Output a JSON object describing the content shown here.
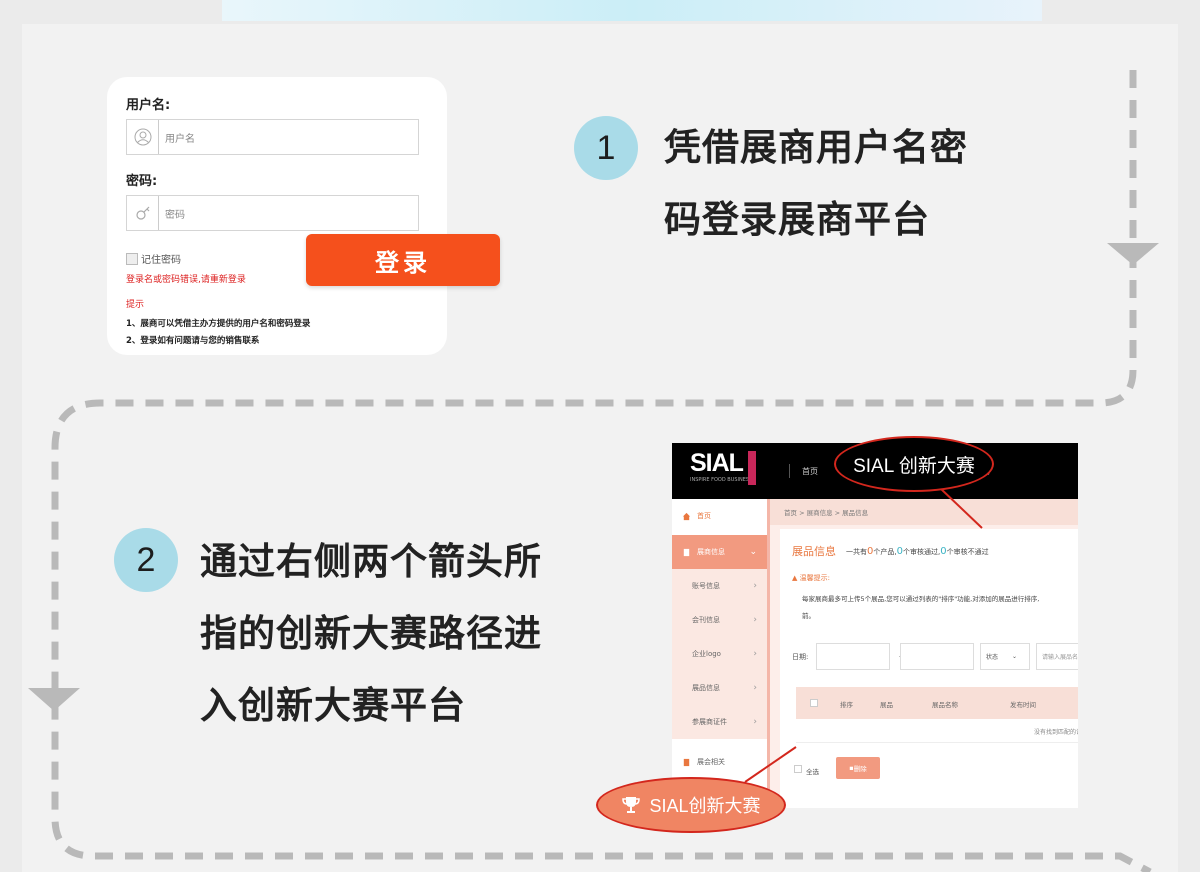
{
  "step1": {
    "number": "1",
    "line1": "凭借展商用户名密",
    "line2": "码登录展商平台"
  },
  "step2": {
    "number": "2",
    "line1": "通过右侧两个箭头所",
    "line2": "指的创新大赛路径进",
    "line3": "入创新大赛平台"
  },
  "login": {
    "username_label": "用户名:",
    "username_placeholder": "用户名",
    "password_label": "密码:",
    "password_placeholder": "密码",
    "remember": "记住密码",
    "error": "登录名或密码错误,请重新登录",
    "tips_title": "提示",
    "tip1": "1、展商可以凭借主办方提供的用户名和密码登录",
    "tip2": "2、登录如有问题请与您的销售联系",
    "button": "登录"
  },
  "platform": {
    "logo": "SIAL",
    "logo_sub": "INSPIRE FOOD BUSINESS",
    "nav_home": "首页",
    "nav_more": "动",
    "breadcrumb": "首页 > 展商信息 > 展品信息",
    "sidebar": [
      {
        "label": "首页"
      },
      {
        "label": "展商信息"
      },
      {
        "label": "账号信息"
      },
      {
        "label": "会刊信息"
      },
      {
        "label": "企业logo"
      },
      {
        "label": "展品信息"
      },
      {
        "label": "参展商证件"
      },
      {
        "label": "展会相关"
      }
    ],
    "title": "展品信息",
    "stats_pre": "一共有",
    "stats_n1": "0",
    "stats_mid1": "个产品,",
    "stats_n2": "0",
    "stats_mid2": "个审核通过,",
    "stats_n3": "0",
    "stats_post": "个审核不通过",
    "warn_title": "温馨提示:",
    "warn_body": "每家展商最多可上传5个展品,您可以通过列表的\"排序\"功能,对添加的展品进行排序,",
    "warn_body2": "前。",
    "date_label": "日期:",
    "date_sep": "-",
    "status_select": "状态",
    "search_placeholder": "请输入展品名",
    "columns": [
      "排序",
      "展品",
      "展品名称",
      "发布时间"
    ],
    "empty": "没有找到匹配的记",
    "select_all": "全选",
    "delete": "删除"
  },
  "callouts": {
    "top": "SIAL 创新大赛",
    "bottom": "SIAL创新大赛"
  },
  "colors": {
    "accent_orange": "#f5501c",
    "badge_blue": "#a9dbe8",
    "callout_red": "#d3271d",
    "callout_fill": "#f08563"
  }
}
